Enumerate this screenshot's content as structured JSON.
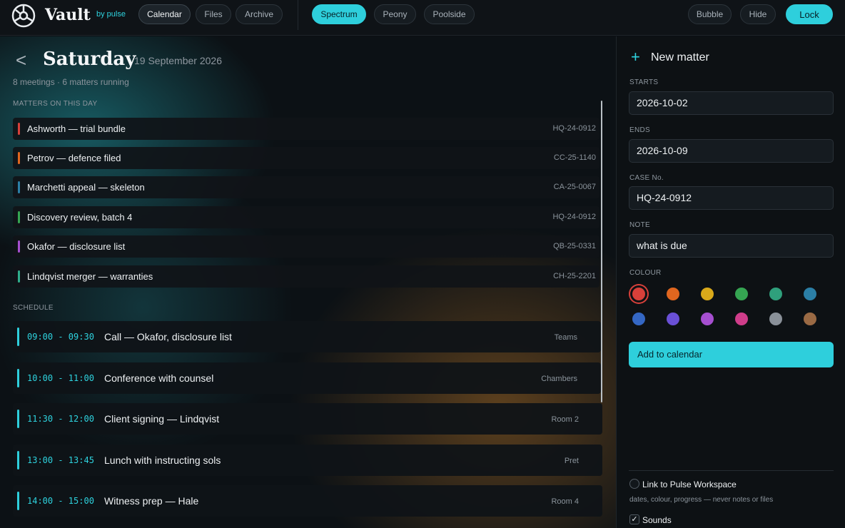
{
  "brand": {
    "name": "Vault",
    "sub": "by pulse"
  },
  "nav": {
    "calendar": "Calendar",
    "files": "Files",
    "archive": "Archive"
  },
  "themes": {
    "spectrum": "Spectrum",
    "peony": "Peony",
    "poolside": "Poolside"
  },
  "actions": {
    "bubble": "Bubble",
    "hide": "Hide",
    "lock": "Lock"
  },
  "day": {
    "back_icon": "chevron-left-icon",
    "title": "Saturday",
    "date": "19 September 2026",
    "summary": "8 meetings · 6 matters running",
    "matters_label": "MATTERS ON THIS DAY",
    "schedule_label": "SCHEDULE"
  },
  "matters": [
    {
      "name": "Ashworth — trial bundle",
      "code": "HQ-24-0912",
      "color": "#d7403a"
    },
    {
      "name": "Petrov — defence filed",
      "code": "CC-25-1140",
      "color": "#e0661f"
    },
    {
      "name": "Marchetti appeal — skeleton",
      "code": "CA-25-0067",
      "color": "#2b7fa6"
    },
    {
      "name": "Discovery review, batch 4",
      "code": "HQ-24-0912",
      "color": "#35a552"
    },
    {
      "name": "Okafor — disclosure list",
      "code": "QB-25-0331",
      "color": "#a64fd0"
    },
    {
      "name": "Lindqvist merger — warranties",
      "code": "CH-25-2201",
      "color": "#2fae8c"
    }
  ],
  "schedule": [
    {
      "time": "09:00 - 09:30",
      "title": "Call — Okafor, disclosure list",
      "place": "Teams"
    },
    {
      "time": "10:00 - 11:00",
      "title": "Conference with counsel",
      "place": "Chambers"
    },
    {
      "time": "11:30 - 12:00",
      "title": "Client signing — Lindqvist",
      "place": "Room 2"
    },
    {
      "time": "13:00 - 13:45",
      "title": "Lunch with instructing sols",
      "place": "Pret"
    },
    {
      "time": "14:00 - 15:00",
      "title": "Witness prep — Hale",
      "place": "Room 4"
    }
  ],
  "form": {
    "title": "New matter",
    "starts_label": "STARTS",
    "starts_value": "2026-10-02",
    "ends_label": "ENDS",
    "ends_value": "2026-10-09",
    "case_label": "CASE No.",
    "case_value": "HQ-24-0912",
    "note_label": "NOTE",
    "note_value": "what is due",
    "colour_label": "COLOUR",
    "colours": [
      "#d7403a",
      "#e0661f",
      "#d9a91a",
      "#35a552",
      "#2fa07c",
      "#2b7fa6",
      "#3467c4",
      "#6a50d6",
      "#a64fd0",
      "#cf3d8a",
      "#8a9199",
      "#9a6a44"
    ],
    "selected_colour": 0,
    "add_button": "Add to calendar",
    "link_label": "Link to Pulse Workspace",
    "link_hint": "dates, colour, progress — never notes or files",
    "link_checked": false,
    "sounds_label": "Sounds",
    "sounds_checked": true
  }
}
